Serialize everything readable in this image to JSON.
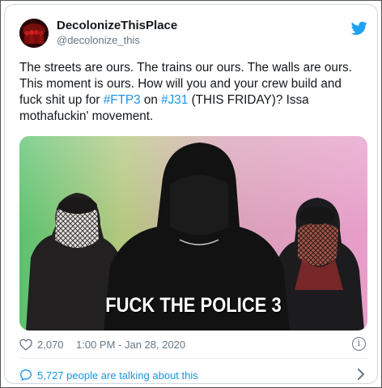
{
  "author": {
    "display_name": "DecolonizeThisPlace",
    "handle": "@decolonize_this"
  },
  "icons": {
    "avatar": "avatar-image",
    "twitter": "twitter-bird-icon",
    "like": "heart-icon",
    "info": "info-icon",
    "conversation": "speech-bubble-icon",
    "chevron": "chevron-right-icon"
  },
  "tweet": {
    "text_part1": "The streets are ours. The trains our ours. The walls are ours. This moment is ours. How will you and your crew build and fuck shit up for ",
    "hashtag1": "#FTP3",
    "text_part2": " on ",
    "hashtag2": "#J31",
    "text_part3": " (THIS FRIDAY)? Issa mothafuckin' movement."
  },
  "media": {
    "caption": "FUCK THE POLICE 3"
  },
  "stats": {
    "likes": "2,070",
    "timestamp": "1:00 PM - Jan 28, 2020"
  },
  "conversation": {
    "text": "5,727 people are talking about this"
  },
  "colors": {
    "link": "#1b95e0",
    "secondary_text": "#657786",
    "primary_text": "#14171a"
  }
}
